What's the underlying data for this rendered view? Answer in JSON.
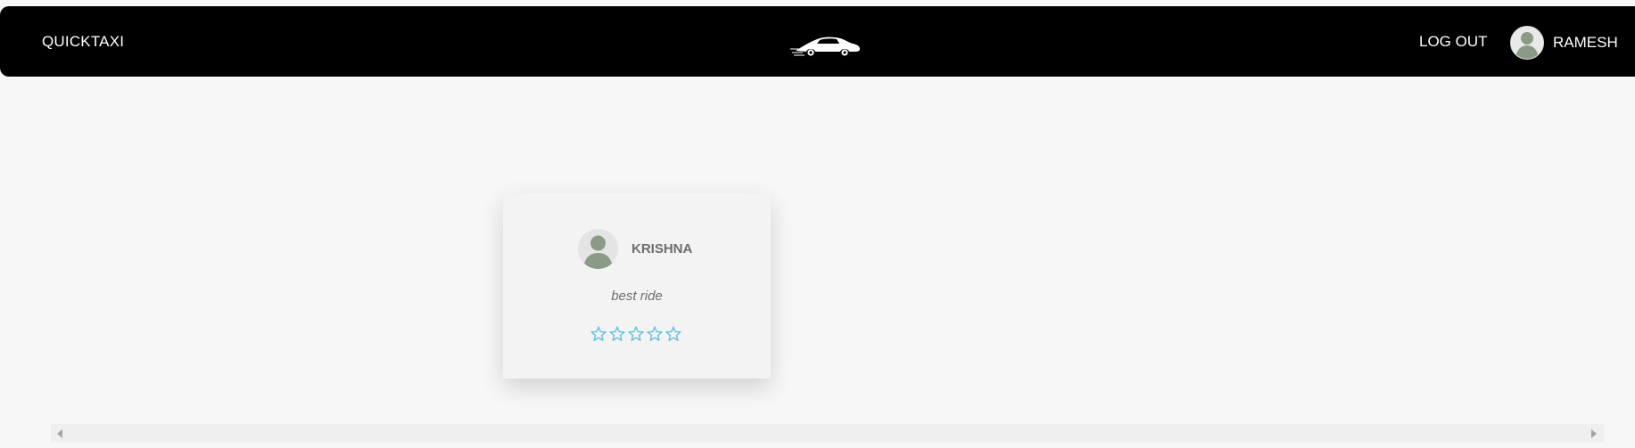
{
  "navbar": {
    "brand": "QUICKTAXI",
    "logo_icon": "car-icon",
    "logout_label": "LOG OUT",
    "user_name": "RAMESH",
    "user_avatar_icon": "user-avatar-icon"
  },
  "review": {
    "reviewer_name": "KRISHNA",
    "reviewer_avatar_icon": "user-avatar-icon",
    "comment": "best ride",
    "rating": 0,
    "rating_max": 5,
    "star_color": "#5bc0de"
  },
  "colors": {
    "navbar_bg": "#000000",
    "page_bg": "#f7f7f7",
    "card_bg": "#f3f3f3",
    "star": "#5bc0de"
  },
  "scrollbar": {
    "left_icon": "scroll-left-arrow-icon",
    "right_icon": "scroll-right-arrow-icon"
  }
}
